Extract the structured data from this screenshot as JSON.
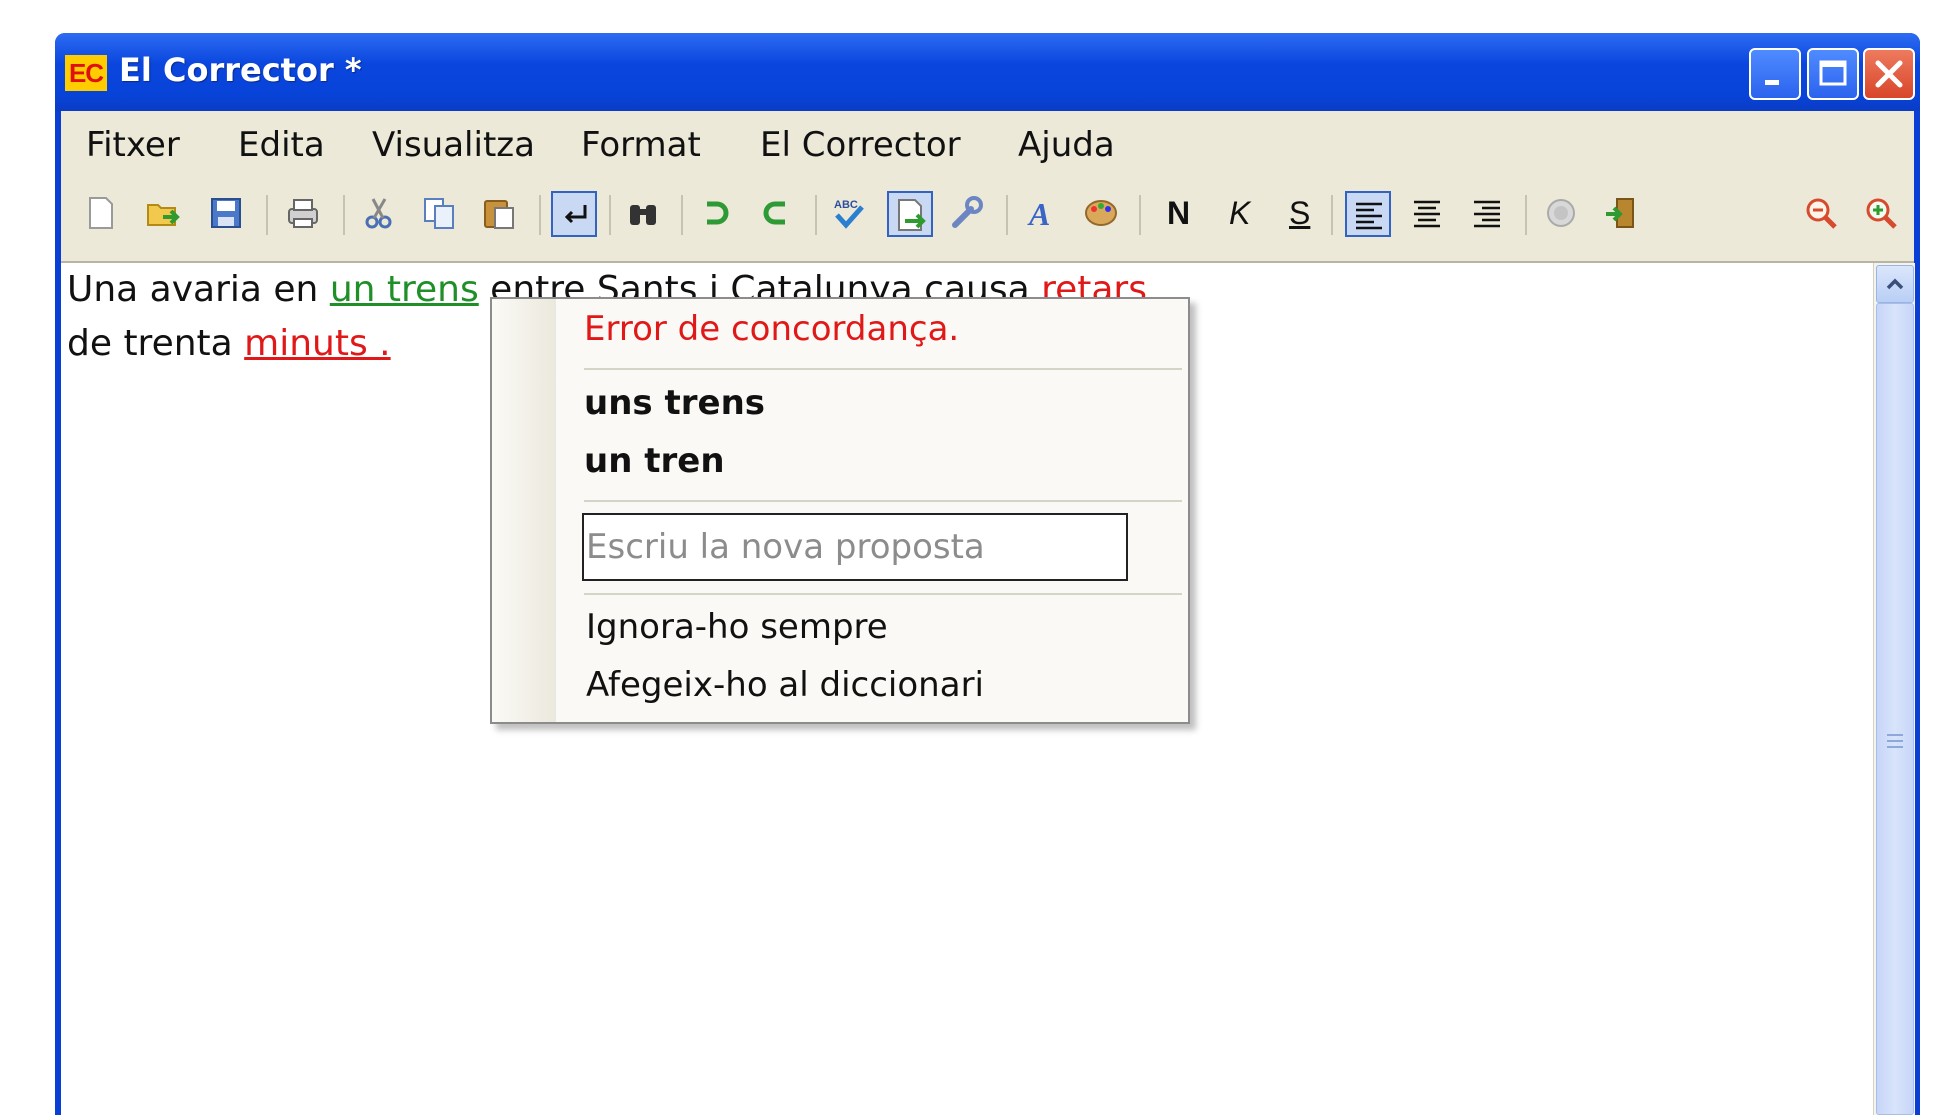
{
  "window": {
    "icon_text": "EC",
    "title": "El Corrector *",
    "controls": [
      "minimize-icon",
      "maximize-icon",
      "close-icon"
    ]
  },
  "menu": {
    "items": [
      "Fitxer",
      "Edita",
      "Visualitza",
      "Format",
      "El Corrector",
      "Ajuda"
    ]
  },
  "toolbar": {
    "icons": [
      "new-document-icon",
      "open-folder-icon",
      "save-icon",
      "print-icon",
      "cut-icon",
      "copy-icon",
      "paste-icon",
      "line-break-icon",
      "find-icon",
      "undo-icon",
      "redo-icon",
      "spellcheck-icon",
      "next-error-icon",
      "settings-wrench-icon",
      "font-icon",
      "color-palette-icon",
      "align-left-icon",
      "align-center-icon",
      "align-right-icon",
      "info-icon",
      "exit-icon",
      "zoom-out-icon",
      "zoom-in-icon"
    ],
    "bold_label": "N",
    "italic_label": "K",
    "underline_label": "S"
  },
  "editor": {
    "line1_before": "Una avaria en ",
    "line1_error1": "un trens",
    "line1_middle": " entre Sants i Catalunya causa ",
    "line1_error2": "retars",
    "line2_before": "de trenta ",
    "line2_error": "minuts ."
  },
  "context_menu": {
    "error_message": "Error de concordança.",
    "suggestions": [
      "uns trens",
      "un tren"
    ],
    "input_placeholder": "Escriu la nova proposta",
    "actions": [
      "Ignora-ho sempre",
      "Afegeix-ho al diccionari"
    ]
  },
  "colors": {
    "grammar_error": "#1f8f28",
    "spelling_error": "#e01818",
    "title_bar": "#0a46de"
  }
}
